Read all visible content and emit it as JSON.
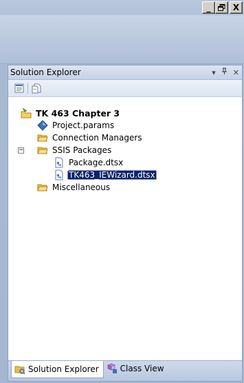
{
  "window": {
    "minimize_label": "_",
    "restore_label": "❐",
    "close_label": "X"
  },
  "panel": {
    "title": "Solution Explorer",
    "pin_label": "▾",
    "autohide_label": "⎕",
    "close_label": "✕"
  },
  "toolbar": {
    "items": [
      "properties-icon",
      "show-all-files-icon"
    ]
  },
  "tree": {
    "solution": "TK 463 Chapter 3",
    "params": "Project.params",
    "connection_managers": "Connection Managers",
    "ssis_packages": "SSIS Packages",
    "ssis_expander": "−",
    "package1": "Package.dtsx",
    "package2": "TK463_IEWizard.dtsx",
    "miscellaneous": "Miscellaneous"
  },
  "tabs": {
    "solution_explorer": "Solution Explorer",
    "class_view": "Class View"
  },
  "colors": {
    "selection": "#0a246a",
    "folder": "#f3cf63",
    "accent": "#3d6fbd"
  }
}
